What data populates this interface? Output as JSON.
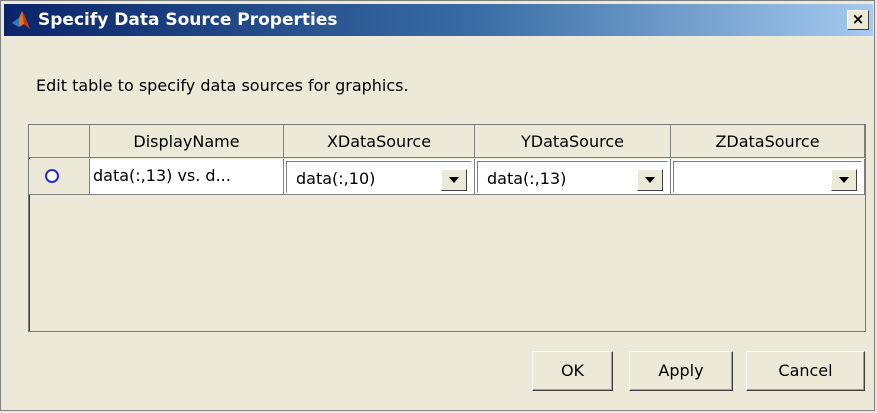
{
  "window": {
    "title": "Specify Data Source Properties",
    "close_label": "×",
    "title_icon": "matlab-logo-icon"
  },
  "instructions": "Edit table to specify data sources for graphics.",
  "table": {
    "columns": [
      "",
      "DisplayName",
      "XDataSource",
      "YDataSource",
      "ZDataSource"
    ],
    "rows": [
      {
        "selected": true,
        "display_name": "data(:,13) vs. d...",
        "x_source": "data(:,10)",
        "y_source": "data(:,13)",
        "z_source": ""
      }
    ]
  },
  "buttons": {
    "ok": "OK",
    "apply": "Apply",
    "cancel": "Cancel"
  },
  "colors": {
    "title_bar_start": "#0a246a",
    "title_bar_end": "#a6caf0",
    "dialog_bg": "#ece9d8",
    "radio": "#2a2ad0"
  }
}
